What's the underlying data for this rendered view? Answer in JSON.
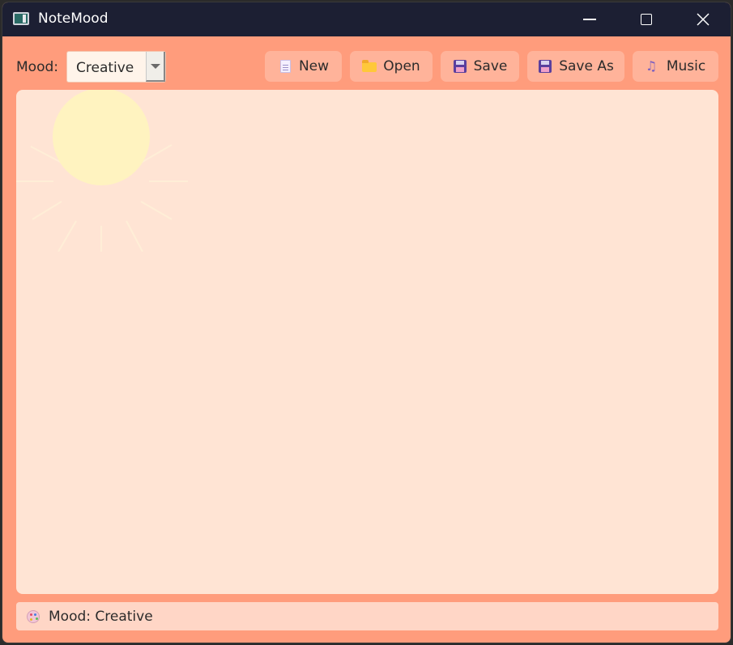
{
  "window": {
    "title": "NoteMood",
    "controls": {
      "minimize": "minimize",
      "maximize": "maximize",
      "close": "close"
    }
  },
  "toolbar": {
    "mood_label": "Mood:",
    "mood_selected": "Creative",
    "buttons": {
      "new": "New",
      "open": "Open",
      "save": "Save",
      "save_as": "Save As",
      "music": "Music"
    }
  },
  "editor": {
    "content": ""
  },
  "status": {
    "text": "Mood: Creative"
  },
  "colors": {
    "background": "#ff9c7c",
    "titlebar": "#1c1f33",
    "editor_bg": "#ffe4d4",
    "button_bg": "#ffb39a",
    "status_bg": "#ffd6c6",
    "sun": "#fff3c0"
  },
  "icons": {
    "new": "document-icon",
    "open": "folder-icon",
    "save": "floppy-disk-icon",
    "save_as": "floppy-disk-icon",
    "music": "music-note-icon",
    "status": "palette-icon"
  }
}
